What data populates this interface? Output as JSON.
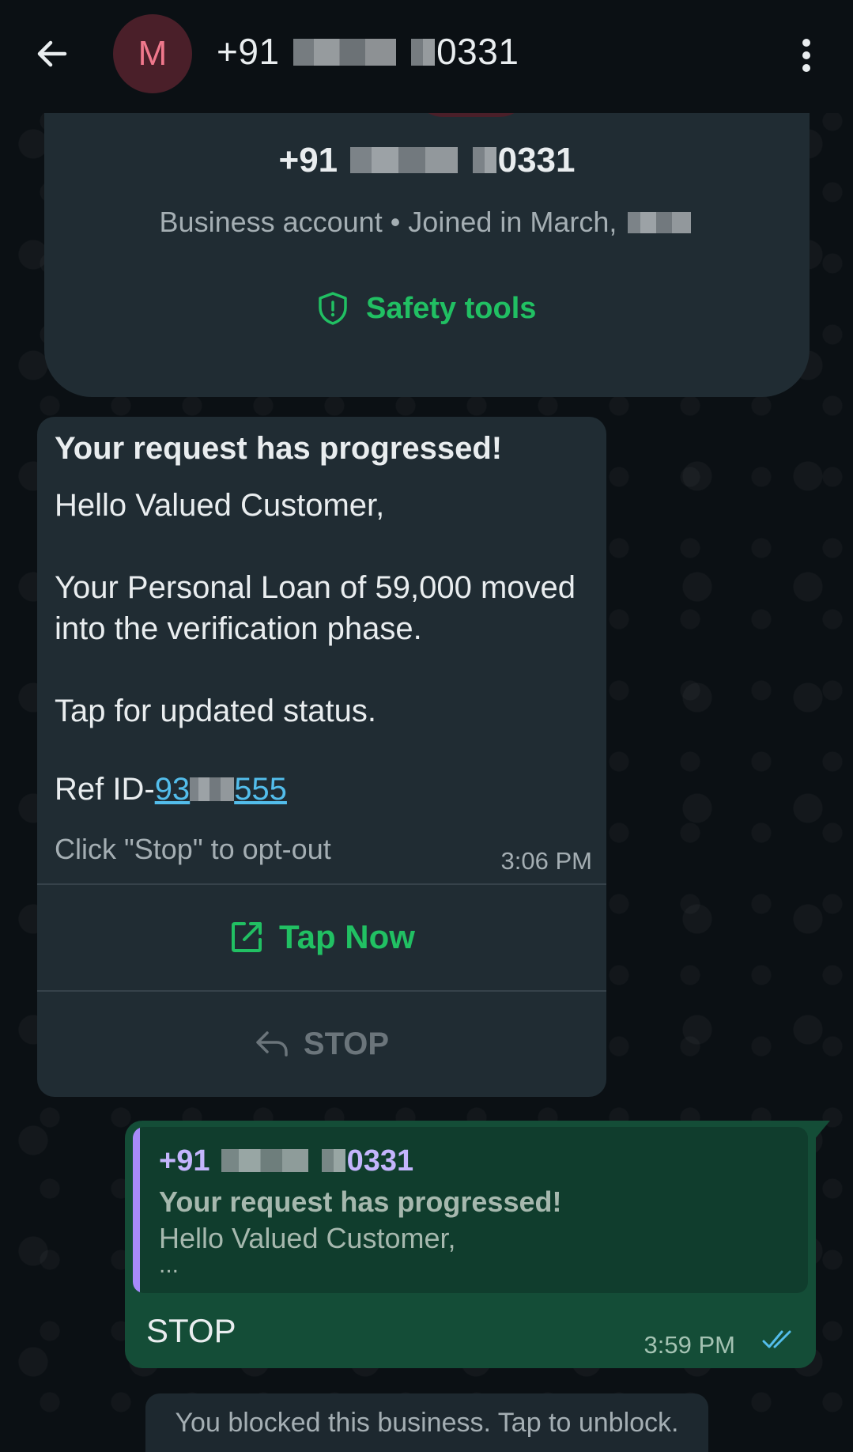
{
  "header": {
    "avatar_letter": "M",
    "title_prefix": "+91",
    "title_suffix": "0331"
  },
  "profile": {
    "number_prefix": "+91",
    "number_suffix": "0331",
    "subtitle": "Business account • Joined in March,",
    "safety_label": "Safety tools"
  },
  "incoming": {
    "title": "Your request has progressed!",
    "greeting": "Hello Valued Customer,",
    "body_line": "Your Personal Loan of 59,000 moved into the verification phase.",
    "tap_line": "Tap for updated status.",
    "ref_label": "Ref ID-",
    "ref_prefix": "93",
    "ref_suffix": "555",
    "optout": "Click \"Stop\" to opt-out",
    "time": "3:06 PM",
    "tap_now_label": "Tap Now",
    "stop_label": "STOP"
  },
  "outgoing": {
    "quote_sender_prefix": "+91",
    "quote_sender_suffix": "0331",
    "quote_title": "Your request has progressed!",
    "quote_line": "Hello Valued Customer,",
    "quote_ellipsis": "...",
    "text": "STOP",
    "time": "3:59 PM"
  },
  "blocked_notice": "You blocked this business. Tap to unblock.",
  "colors": {
    "accent_green": "#21c063",
    "link_blue": "#53bdeb",
    "outgoing_bubble": "#144d37",
    "incoming_bubble": "#202c33",
    "quote_bar": "#a78bfa"
  }
}
